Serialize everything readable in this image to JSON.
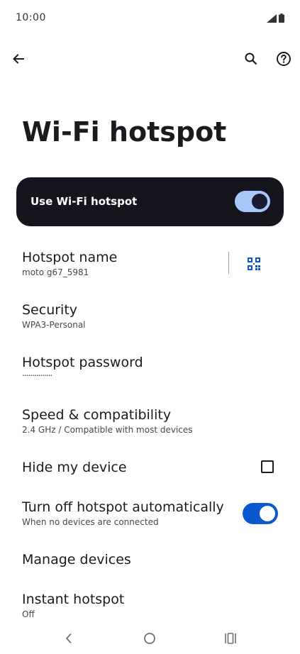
{
  "status_bar": {
    "time": "10:00"
  },
  "app_bar": {
    "back_icon": "arrow-back-icon",
    "search_icon": "search-icon",
    "help_icon": "help-circle-icon"
  },
  "page": {
    "title": "Wi-Fi hotspot"
  },
  "main_switch": {
    "label": "Use Wi-Fi hotspot",
    "enabled": true
  },
  "settings": {
    "hotspot_name": {
      "title": "Hotspot name",
      "value": "moto g67_5981"
    },
    "security": {
      "title": "Security",
      "value": "WPA3-Personal"
    },
    "password": {
      "title": "Hotspot password",
      "value": "..............."
    },
    "speed": {
      "title": "Speed & compatibility",
      "value": "2.4 GHz / Compatible with most devices"
    },
    "hide_device": {
      "title": "Hide my device",
      "checked": false
    },
    "auto_off": {
      "title": "Turn off hotspot automatically",
      "value": "When no devices are connected",
      "enabled": true
    },
    "manage_devices": {
      "title": "Manage devices"
    },
    "instant_hotspot": {
      "title": "Instant hotspot",
      "value": "Off"
    }
  },
  "colors": {
    "accent": "#0b57d0",
    "card_background": "#15151d",
    "main_toggle_track": "#a8c7fa"
  }
}
